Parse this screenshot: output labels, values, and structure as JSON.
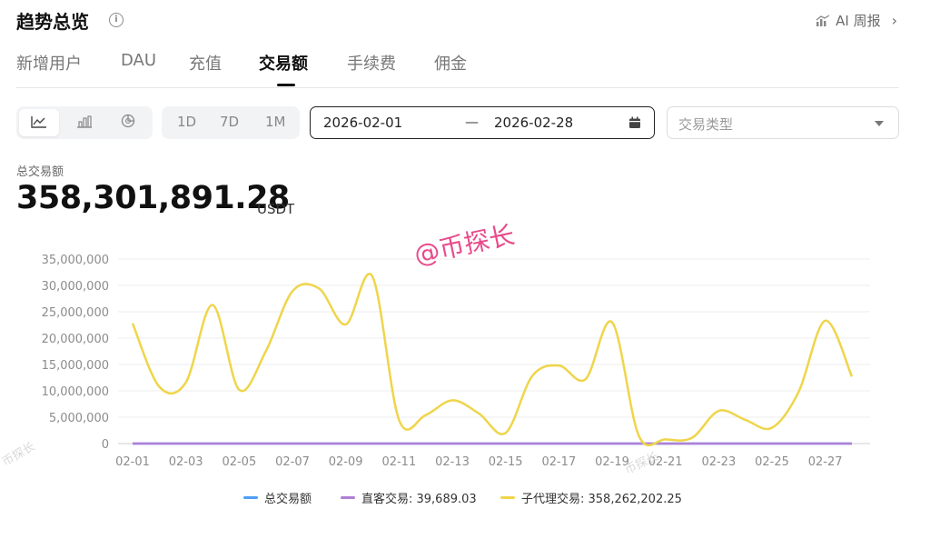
{
  "header": {
    "title": "趋势总览",
    "ai_label": "AI 周报"
  },
  "tabs": [
    {
      "label": "新增用户"
    },
    {
      "label": "DAU"
    },
    {
      "label": "充值"
    },
    {
      "label": "交易额",
      "active": true
    },
    {
      "label": "手续费"
    },
    {
      "label": "佣金"
    }
  ],
  "controls": {
    "ranges": [
      "1D",
      "7D",
      "1M"
    ],
    "date_start": "2026-02-01",
    "date_sep": "—",
    "date_end": "2026-02-28",
    "type_placeholder": "交易类型",
    "chart_type_icons": [
      "line-chart-icon",
      "bar-chart-icon",
      "pie-chart-icon"
    ]
  },
  "summary": {
    "label": "总交易额",
    "value": "358,301,891.28",
    "unit": "USDT"
  },
  "watermark": {
    "main": "@币探长",
    "small": "币探长"
  },
  "legend": [
    {
      "text": "总交易额",
      "color": "#4e9ff5"
    },
    {
      "text": "直客交易: 39,689.03",
      "color": "#b07fd6"
    },
    {
      "text": "子代理交易: 358,262,202.25",
      "color": "#efd54a"
    }
  ],
  "chart_data": {
    "type": "line",
    "x": [
      "02-01",
      "02-02",
      "02-03",
      "02-04",
      "02-05",
      "02-06",
      "02-07",
      "02-08",
      "02-09",
      "02-10",
      "02-11",
      "02-12",
      "02-13",
      "02-14",
      "02-15",
      "02-16",
      "02-17",
      "02-18",
      "02-19",
      "02-20",
      "02-21",
      "02-22",
      "02-23",
      "02-24",
      "02-25",
      "02-26",
      "02-27",
      "02-28"
    ],
    "x_tick_labels": [
      "02-01",
      "02-03",
      "02-05",
      "02-07",
      "02-09",
      "02-11",
      "02-13",
      "02-15",
      "02-17",
      "02-19",
      "02-21",
      "02-23",
      "02-25",
      "02-27"
    ],
    "y_tick_labels": [
      "0",
      "5,000,000",
      "10,000,000",
      "15,000,000",
      "20,000,000",
      "25,000,000",
      "30,000,000",
      "35,000,000"
    ],
    "ylim": [
      0,
      35000000
    ],
    "series": [
      {
        "name": "总交易额",
        "color": "#4e9ff5",
        "values": [
          0,
          0,
          0,
          0,
          0,
          0,
          0,
          0,
          0,
          0,
          0,
          0,
          0,
          0,
          0,
          0,
          0,
          0,
          0,
          0,
          0,
          0,
          0,
          0,
          0,
          0,
          0,
          0
        ]
      },
      {
        "name": "直客交易",
        "color": "#b07fd6",
        "values": [
          0,
          0,
          0,
          0,
          0,
          0,
          0,
          0,
          0,
          0,
          0,
          0,
          0,
          0,
          0,
          0,
          0,
          0,
          0,
          0,
          0,
          0,
          0,
          0,
          0,
          0,
          0,
          0
        ]
      },
      {
        "name": "子代理交易",
        "color": "#efd54a",
        "values": [
          22800000,
          10800000,
          11600000,
          26300000,
          10200000,
          17500000,
          28900000,
          29400000,
          22600000,
          31700000,
          4500000,
          5400000,
          8200000,
          5700000,
          2000000,
          12800000,
          14800000,
          12200000,
          23000000,
          1500000,
          800000,
          1100000,
          6200000,
          4500000,
          3000000,
          9800000,
          23300000,
          12700000
        ]
      }
    ],
    "grid": true,
    "legend_position": "bottom"
  }
}
